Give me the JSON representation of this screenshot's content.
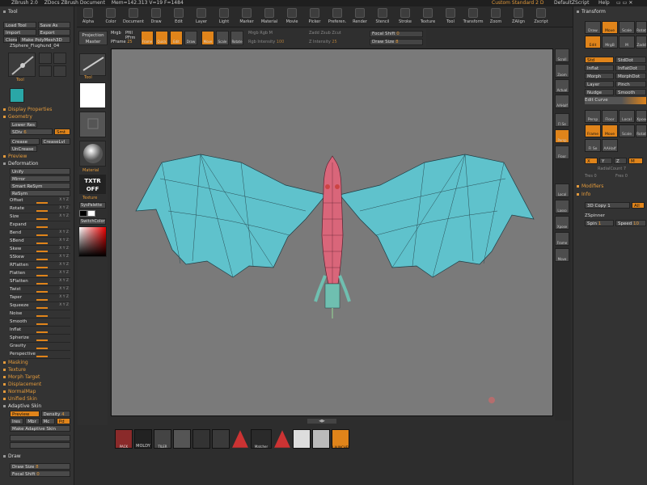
{
  "title_bar": {
    "app": "ZBrush 2.0",
    "doc": "ZDocs ZBrush Document",
    "mem": "Mem=142.313 V=19 F=1484",
    "layout": "Custom Standard 2 D",
    "script": "DefaultZScript",
    "help": "Help"
  },
  "menu": [
    "Alpha",
    "Color",
    "Document",
    "Draw",
    "Edit",
    "Layer",
    "Light",
    "Marker",
    "Material",
    "Movie",
    "Picker",
    "Preferen.",
    "Render",
    "Stencil",
    "Stroke",
    "Texture",
    "Tool",
    "Transform",
    "Zoom",
    "ZAlign",
    "Zscript"
  ],
  "left_panel": {
    "tool_header": "Tool",
    "row_load": [
      "Load Tool",
      "Save As"
    ],
    "row_import": [
      "Import",
      "Export"
    ],
    "row_clone": [
      "Clone",
      "Make PolyMesh3D"
    ],
    "current_tool": "ZSphere_Flughund_04",
    "tool_label": "Tool",
    "display_properties": "Display Properties",
    "geometry": "Geometry",
    "lower_res": "Lower Res",
    "sdiv_label": "SDiv",
    "sdiv_value": "6",
    "smt": "Smt",
    "crease": "Crease",
    "crease_lvl": "CreaseLvl",
    "uncrease": "UnCrease",
    "preview": "Preview",
    "deformation": "Deformation",
    "unify": "Unify",
    "mirror": "Mirror",
    "smart_resym": "Smart ReSym",
    "resym": "ReSym",
    "sliders": [
      "Offset",
      "Rotate",
      "Size",
      "Expand",
      "Bend",
      "SBend",
      "Skew",
      "SSkew",
      "RFlatten",
      "Flatten",
      "SFlatten",
      "Twist",
      "Taper",
      "Squeeze",
      "Noise",
      "Smooth",
      "Inflat",
      "Spherize",
      "Gravity",
      "Perspective"
    ],
    "axis_tag": "X Y Z",
    "subs": [
      "Masking",
      "Texture",
      "Morph Target",
      "Displacement",
      "NormalMap",
      "Unified Skin"
    ],
    "adaptive_skin": "Adaptive Skin",
    "preview_btn": "Preview",
    "density": "Density",
    "density_val": "4",
    "flags": [
      "Ires",
      "Mbr",
      "Mc",
      "Pd"
    ],
    "make_adaptive": "Make Adaptive Skin",
    "draw": "Draw",
    "draw_size": "Draw Size",
    "draw_size_val": "8",
    "focal_shift": "Focal Shift",
    "focal_shift_val": "0"
  },
  "left_tools": {
    "tool": "Tool",
    "material": "Material",
    "txtr_off": "TXTR OFF",
    "texture": "Texture",
    "syspalette": "SysPalette",
    "switchcolor": "SwitchColor"
  },
  "top_controls": {
    "projection_master": "Projection Master",
    "edit": "Edit",
    "draw": "Draw",
    "move": "Move",
    "scale": "Scale",
    "rotate": "Rotate",
    "mrgb": "Mrgb",
    "rgb": "Rgb",
    "m": "M",
    "zadd": "Zadd",
    "zsub": "Zsub",
    "rgb_intensity": "Rgb Intensity",
    "rgb_intensity_val": "100",
    "z_intensity": "Z Intensity",
    "z_intensity_val": "25",
    "zcut": "Zcut",
    "pfill": "Pfill",
    "pfrm": "PFrm",
    "pframe": "PFrame",
    "pframe_val": "25",
    "focal_shift": "Focal Shift",
    "focal_shift_val": "0",
    "draw_size": "Draw Size",
    "draw_size_val": "8"
  },
  "right_toolbar": [
    "Scroll",
    "Zoom",
    "Actual",
    "AAHalf",
    "Fl Se",
    "Persp",
    "Floor",
    "Local",
    "Lasso",
    "Xpose",
    "Frame",
    "Move",
    "Scale",
    "Rotate",
    "Transp",
    "Ghost"
  ],
  "right_panel": {
    "transform": "Transform",
    "top_buttons": [
      "Draw",
      "Move",
      "Scale",
      "Rotate",
      "Edit",
      "MrgB",
      "M",
      "Zadd"
    ],
    "std": "Std",
    "stddot": "StdDot",
    "inflat": "Inflat",
    "inflatdot": "InflatDot",
    "morph": "Morph",
    "morphdot": "MorphDot",
    "layer": "Layer",
    "pinch": "Pinch",
    "nudge": "Nudge",
    "smooth": "Smooth",
    "edit_curve": "Edit Curve",
    "mid_buttons": [
      "Persp",
      "Floor",
      "Local",
      "Xpose",
      "Frame",
      "Move",
      "Scale",
      "Rotate",
      "Fl Se",
      "AAHalf"
    ],
    "sym": [
      "X",
      "Y",
      "Z",
      "M"
    ],
    "radial": "RadialCount",
    "radial_val": "7",
    "tres": "Tres",
    "tres_val": "0",
    "fres": "Fres",
    "fres_val": "0",
    "modifiers": "Modifiers",
    "info": "Info",
    "copy3d": "3D Copy",
    "copy3d_val": "1",
    "all": "All",
    "zspinner": "ZSpinner",
    "spin": "Spin",
    "spin_val": "1",
    "speed": "Speed",
    "speed_val": "10"
  },
  "shelf": [
    {
      "icon": "pack-icon",
      "label": "PACK"
    },
    {
      "icon": "moldy-icon",
      "label": "MOLDY"
    },
    {
      "icon": "tiler-icon",
      "label": "TILER"
    },
    {
      "icon": "matcap-icon",
      "label": ""
    },
    {
      "icon": "macro-icon",
      "label": ""
    },
    {
      "icon": "brush-icon",
      "label": ""
    },
    {
      "icon": "warning-icon",
      "label": ""
    },
    {
      "icon": "matcher-icon",
      "label": "Matcher"
    },
    {
      "icon": "warning-icon",
      "label": ""
    },
    {
      "icon": "paper-icon",
      "label": ""
    },
    {
      "icon": "tool-icon",
      "label": ""
    },
    {
      "icon": "zlauncher-icon",
      "label": "LAUNCHER"
    }
  ],
  "colors": {
    "accent": "#e0841a",
    "wing": "#5fc2cc",
    "body": "#d9667a",
    "canvas": "#7a7a7a"
  }
}
